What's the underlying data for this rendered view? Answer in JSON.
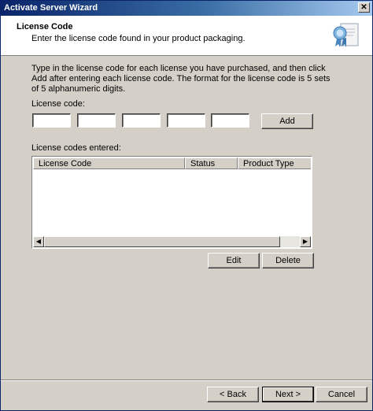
{
  "window": {
    "title": "Activate Server Wizard",
    "close_glyph": "✕"
  },
  "header": {
    "title": "License Code",
    "subtitle": "Enter the license code found in your product packaging.",
    "icon": "license-certificate-icon"
  },
  "body": {
    "instructions": "Type in the license code for each license you have purchased, and then click Add after entering each license code. The format for the license code is 5 sets of 5 alphanumeric digits.",
    "license_code_label": "License code:",
    "code_fields": [
      "",
      "",
      "",
      "",
      ""
    ],
    "add_label": "Add",
    "entered_label": "License codes entered:",
    "columns": [
      "License Code",
      "Status",
      "Product Type"
    ],
    "rows": [],
    "edit_label": "Edit",
    "delete_label": "Delete"
  },
  "footer": {
    "back_label": "< Back",
    "next_label": "Next >",
    "cancel_label": "Cancel"
  }
}
